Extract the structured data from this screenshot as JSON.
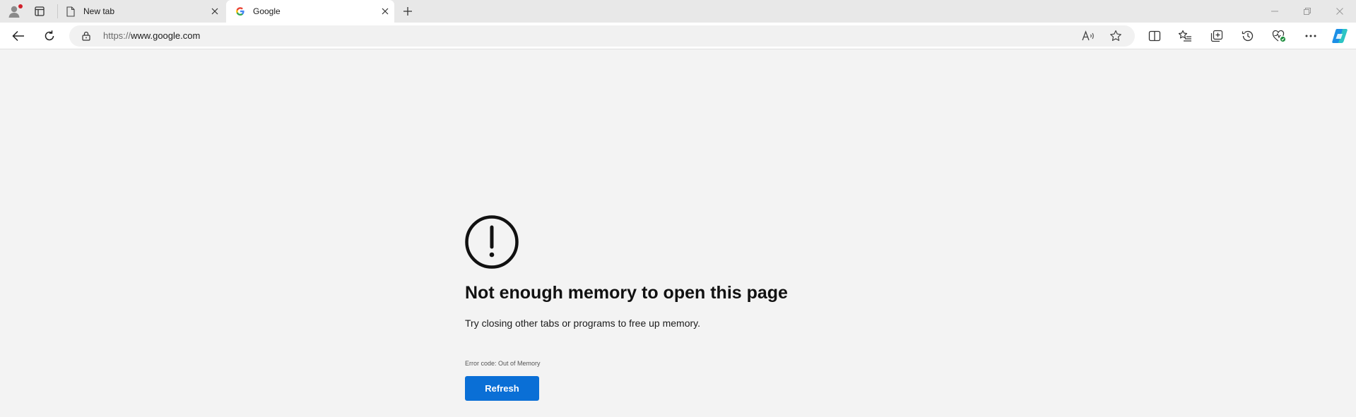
{
  "tabs": [
    {
      "title": "New tab",
      "icon": "page-icon",
      "active": false
    },
    {
      "title": "Google",
      "icon": "google-g-icon",
      "active": true
    }
  ],
  "address_bar": {
    "scheme": "https://",
    "host": "www.google.com"
  },
  "toolbar_icons": [
    "back-icon",
    "refresh-icon",
    "read-aloud-icon",
    "favorite-star-icon",
    "split-screen-icon",
    "favorites-icon",
    "collections-icon",
    "history-icon",
    "browser-essentials-icon",
    "more-icon",
    "copilot-icon"
  ],
  "error_page": {
    "title": "Not enough memory to open this page",
    "description": "Try closing other tabs or programs to free up memory.",
    "error_code": "Error code: Out of Memory",
    "refresh_label": "Refresh"
  },
  "colors": {
    "accent_button": "#0a6fd6",
    "profile_badge": "#d1202a",
    "page_background": "#f3f3f3"
  }
}
